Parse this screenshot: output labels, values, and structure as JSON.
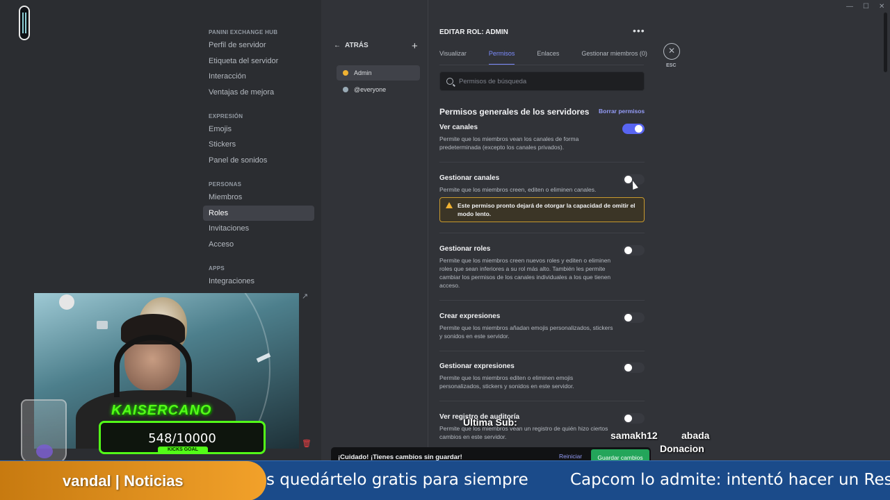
{
  "sidebar": {
    "header_server": "PANINI EXCHANGE HUB",
    "items_server": [
      "Perfil de servidor",
      "Etiqueta del servidor",
      "Interacción",
      "Ventajas de mejora"
    ],
    "header_expression": "EXPRESIÓN",
    "items_expression": [
      "Emojis",
      "Stickers",
      "Panel de sonidos"
    ],
    "header_people": "PERSONAS",
    "items_people": [
      "Miembros",
      "Roles",
      "Invitaciones",
      "Acceso"
    ],
    "active_item": "Roles",
    "header_apps": "APPS",
    "items_apps": [
      "Integraciones"
    ]
  },
  "roles_panel": {
    "back_label": "ATRÁS",
    "add_icon": "plus-icon",
    "roles": [
      {
        "name": "Admin",
        "color": "#f0b232",
        "active": true
      },
      {
        "name": "@everyone",
        "color": "#99aab5",
        "active": false
      }
    ]
  },
  "editor": {
    "title": "EDITAR ROL: ADMIN",
    "tabs": [
      {
        "label": "Visualizar",
        "active": false
      },
      {
        "label": "Permisos",
        "active": true
      },
      {
        "label": "Enlaces",
        "active": false
      },
      {
        "label": "Gestionar miembros (0)",
        "active": false
      }
    ],
    "close_label": "ESC",
    "search_placeholder": "Permisos de búsqueda",
    "section_title": "Permisos generales de los servidores",
    "clear_label": "Borrar permisos",
    "permissions": [
      {
        "name": "Ver canales",
        "desc": "Permite que los miembros vean los canales de forma predeterminada (excepto los canales privados).",
        "enabled": true
      },
      {
        "name": "Gestionar canales",
        "desc": "Permite que los miembros creen, editen o eliminen canales.",
        "enabled": false
      },
      {
        "name": "Gestionar roles",
        "desc": "Permite que los miembros creen nuevos roles y editen o eliminen roles que sean inferiores a su rol más alto. También les permite cambiar los permisos de los canales individuales a los que tienen acceso.",
        "enabled": false
      },
      {
        "name": "Crear expresiones",
        "desc": "Permite que los miembros añadan emojis personalizados, stickers y sonidos en este servidor.",
        "enabled": false
      },
      {
        "name": "Gestionar expresiones",
        "desc": "Permite que los miembros editen o eliminen emojis personalizados, stickers y sonidos en este servidor.",
        "enabled": false
      },
      {
        "name": "Ver registro de auditoría",
        "desc": "Permite que los miembros vean un registro de quién hizo ciertos cambios en este servidor.",
        "enabled": false
      }
    ],
    "warning": "Este permiso pronto dejará de otorgar la capacidad de omitir el modo lento."
  },
  "unsaved_bar": {
    "message": "¡Cuidado! ¡Tienes cambios sin guardar!",
    "reset_label": "Reiniciar",
    "save_label": "Guardar cambios"
  },
  "overlay": {
    "streamer_name": "KAISERCANO",
    "goal_count": "548/10000",
    "goal_label": "KICKS GOAL",
    "last_sub_label": "Última Sub:",
    "last_sub_name": "samakh12",
    "donation_name": "abada",
    "donation_label": "Donacion"
  },
  "ticker": {
    "brand": "vandal | Noticias",
    "headline_1": "s quedártelo gratis para siempre",
    "headline_2": "Capcom lo admite: intentó hacer un Resi"
  },
  "colors": {
    "accent": "#5865f2",
    "link": "#949cf7",
    "save_green": "#23a55a",
    "warning_border": "#c99a2e",
    "kick_green": "#53fc18"
  }
}
